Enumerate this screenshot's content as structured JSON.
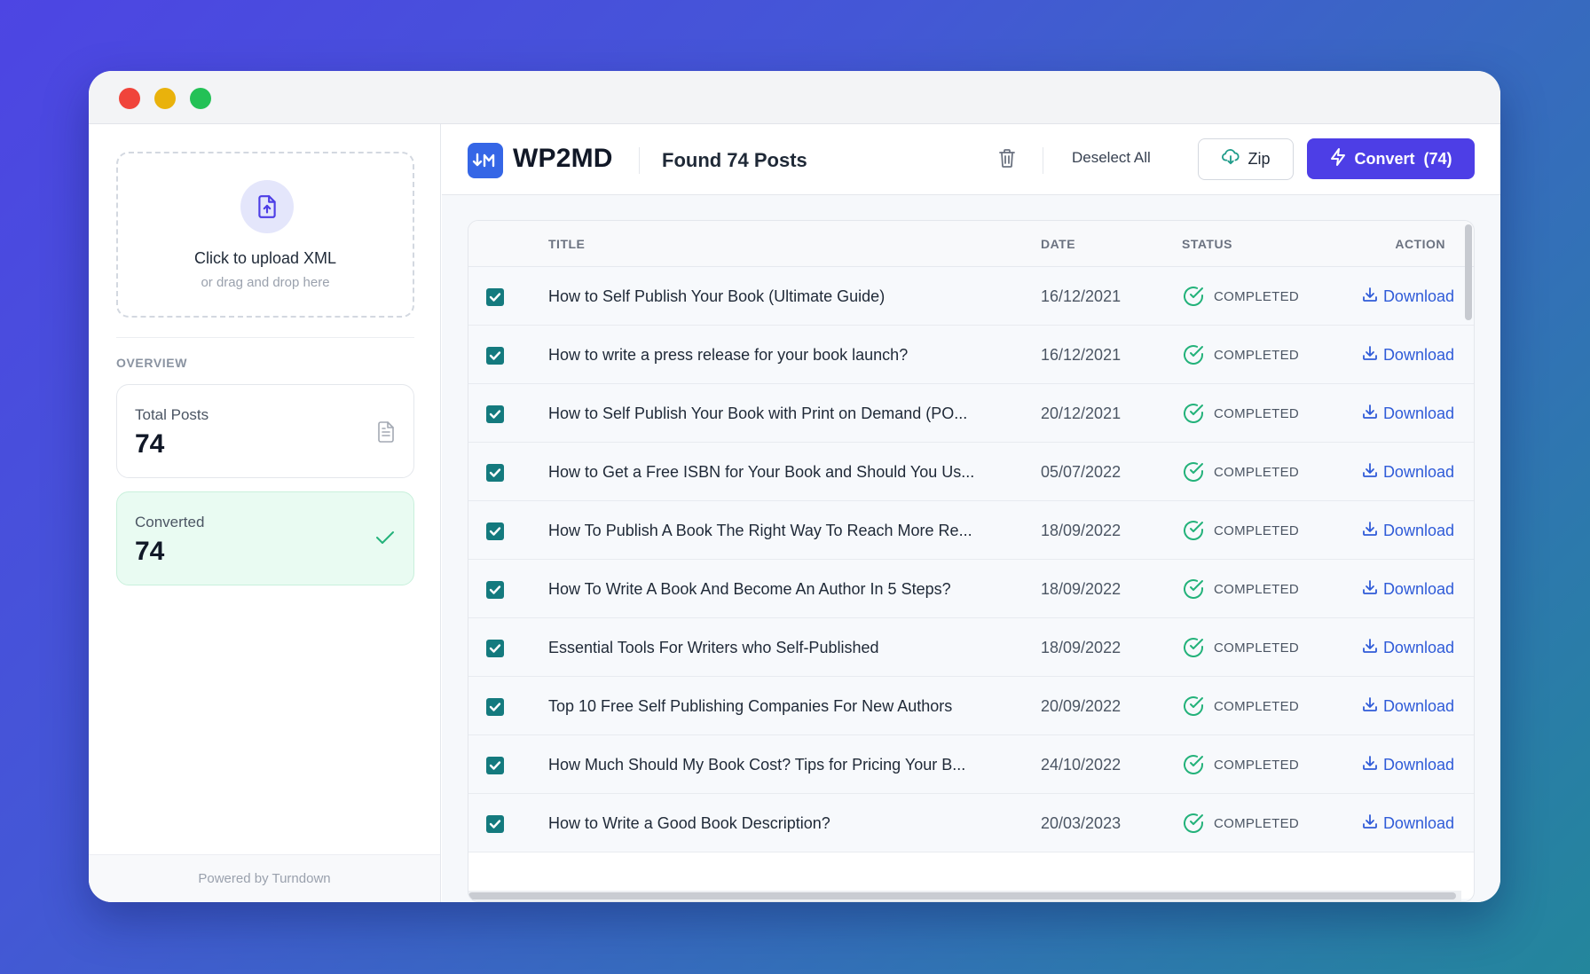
{
  "app": {
    "brand": "WP2MD",
    "footer": "Powered by Turndown"
  },
  "upload": {
    "title": "Click to upload XML",
    "subtitle": "or drag and drop here"
  },
  "overview": {
    "label": "OVERVIEW",
    "total": {
      "label": "Total Posts",
      "value": "74"
    },
    "converted": {
      "label": "Converted",
      "value": "74"
    }
  },
  "header": {
    "found": "Found 74 Posts",
    "deselect": "Deselect All",
    "zip": "Zip",
    "convert": "Convert  (74)"
  },
  "table": {
    "columns": {
      "title": "TITLE",
      "date": "DATE",
      "status": "STATUS",
      "action": "ACTION"
    },
    "rows": [
      {
        "title": "How to Self Publish Your Book (Ultimate Guide)",
        "date": "16/12/2021",
        "status": "COMPLETED",
        "action": "Download",
        "checked": true
      },
      {
        "title": "How to write a press release for your book launch?",
        "date": "16/12/2021",
        "status": "COMPLETED",
        "action": "Download",
        "checked": true
      },
      {
        "title": "How to Self Publish Your Book with Print on Demand (PO...",
        "date": "20/12/2021",
        "status": "COMPLETED",
        "action": "Download",
        "checked": true
      },
      {
        "title": "How to Get a Free ISBN for Your Book and Should You Us...",
        "date": "05/07/2022",
        "status": "COMPLETED",
        "action": "Download",
        "checked": true
      },
      {
        "title": "How To Publish A Book The Right Way To Reach More Re...",
        "date": "18/09/2022",
        "status": "COMPLETED",
        "action": "Download",
        "checked": true
      },
      {
        "title": "How To Write A Book And Become An Author In 5 Steps?",
        "date": "18/09/2022",
        "status": "COMPLETED",
        "action": "Download",
        "checked": true
      },
      {
        "title": "Essential Tools For Writers who Self-Published",
        "date": "18/09/2022",
        "status": "COMPLETED",
        "action": "Download",
        "checked": true
      },
      {
        "title": "Top 10 Free Self Publishing Companies For New Authors",
        "date": "20/09/2022",
        "status": "COMPLETED",
        "action": "Download",
        "checked": true
      },
      {
        "title": "How Much Should My Book Cost? Tips for Pricing Your B...",
        "date": "24/10/2022",
        "status": "COMPLETED",
        "action": "Download",
        "checked": true
      },
      {
        "title": "How to Write a Good Book Description?",
        "date": "20/03/2023",
        "status": "COMPLETED",
        "action": "Download",
        "checked": true
      }
    ]
  },
  "colors": {
    "accent": "#4d3ee6",
    "checkbox": "#147a7e",
    "success": "#23b27a",
    "link": "#2f5bd8"
  },
  "icons": {
    "upload": "file-upload-icon",
    "total": "document-icon",
    "converted": "check-icon",
    "trash": "trash-icon",
    "zip": "cloud-download-icon",
    "convert": "lightning-icon",
    "status": "check-circle-icon",
    "action": "download-icon"
  }
}
